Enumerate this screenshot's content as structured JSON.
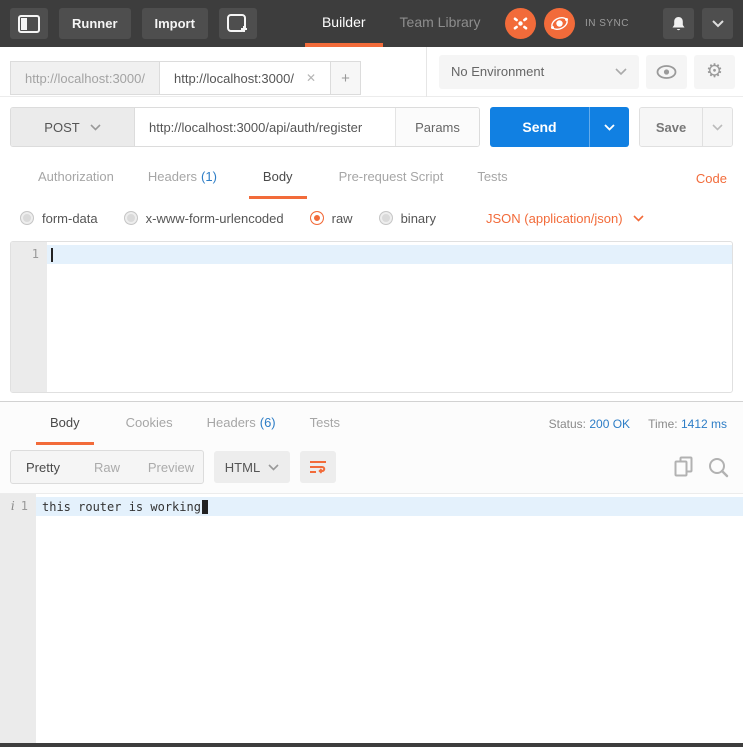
{
  "header": {
    "buttons": {
      "runner": "Runner",
      "import": "Import"
    },
    "nav": {
      "builder": "Builder",
      "team_library": "Team Library"
    },
    "sync_label": "IN SYNC"
  },
  "tabbar": {
    "tab1": "http://localhost:3000/",
    "tab2": "http://localhost:3000/",
    "close_glyph": "✕",
    "new_tab_glyph": "+",
    "environment": "No Environment"
  },
  "request": {
    "method": "POST",
    "url": "http://localhost:3000/api/auth/register",
    "params": "Params",
    "send": "Send",
    "save": "Save",
    "tabs": {
      "authorization": "Authorization",
      "headers": "Headers",
      "headers_count": "(1)",
      "body": "Body",
      "pre_request": "Pre-request Script",
      "tests": "Tests",
      "code": "Code"
    },
    "body_options": {
      "form_data": "form-data",
      "urlencoded": "x-www-form-urlencoded",
      "raw": "raw",
      "binary": "binary",
      "content_type": "JSON (application/json)"
    },
    "editor": {
      "line1": "1",
      "content": ""
    }
  },
  "response": {
    "tabs": {
      "body": "Body",
      "cookies": "Cookies",
      "headers": "Headers",
      "headers_count": "(6)",
      "tests": "Tests"
    },
    "meta": {
      "status_label": "Status:",
      "status_value": "200 OK",
      "time_label": "Time:",
      "time_value": "1412 ms"
    },
    "toolbar": {
      "pretty": "Pretty",
      "raw": "Raw",
      "preview": "Preview",
      "format": "HTML"
    },
    "editor": {
      "gutter_info": "i",
      "line1": "1",
      "content": "this router is working"
    }
  },
  "colors": {
    "accent_orange": "#f26b3a",
    "send_blue": "#1180e2",
    "link_blue": "#2d7dc6",
    "header_dark": "#3d3d3d"
  }
}
